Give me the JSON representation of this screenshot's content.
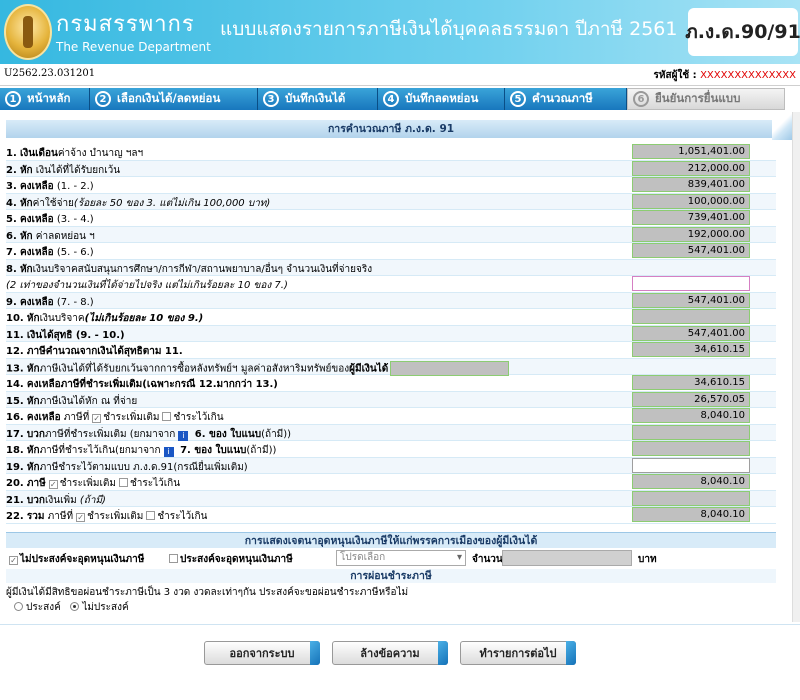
{
  "header": {
    "dept_thai": "กรมสรรพากร",
    "dept_en": "The Revenue Department",
    "form_title": "แบบแสดงรายการภาษีเงินได้บุคคลธรรมดา ปีภาษี 2561",
    "form_code": "ภ.ง.ด.90/91"
  },
  "subheader": {
    "version": "U2562.23.031201",
    "user_label": "รหัสผู้ใช้ :",
    "user_id": "XXXXXXXXXXXXXX"
  },
  "steps": [
    {
      "num": "1",
      "label": "หน้าหลัก",
      "active": true
    },
    {
      "num": "2",
      "label": "เลือกเงินได้/ลดหย่อน",
      "active": true
    },
    {
      "num": "3",
      "label": "บันทึกเงินได้",
      "active": true
    },
    {
      "num": "4",
      "label": "บันทึกลดหย่อน",
      "active": true
    },
    {
      "num": "5",
      "label": "คำนวณภาษี",
      "active": true
    },
    {
      "num": "6",
      "label": "ยืนยันการยื่นแบบ",
      "active": false
    }
  ],
  "calc": {
    "title": "การคำนวณภาษี ภ.ง.ด. 91",
    "r1": {
      "no": "1.",
      "bold": "เงินเดือน",
      "rest": "ค่าจ้าง บำนาญ ฯลฯ",
      "value": "1,051,401.00"
    },
    "r2": {
      "no": "2.",
      "bold": "หัก",
      "rest": " เงินได้ที่ได้รับยกเว้น",
      "value": "212,000.00"
    },
    "r3": {
      "no": "3.",
      "bold": "คงเหลือ",
      "rest": " (1. - 2.)",
      "value": "839,401.00"
    },
    "r4": {
      "no": "4.",
      "bold": "หัก",
      "rest": "ค่าใช้จ่าย",
      "italic": "(ร้อยละ 50 ของ 3. แต่ไม่เกิน 100,000 บาท)",
      "value": "100,000.00"
    },
    "r5": {
      "no": "5.",
      "bold": "คงเหลือ",
      "rest": " (3. - 4.)",
      "value": "739,401.00"
    },
    "r6": {
      "no": "6.",
      "bold": "หัก",
      "rest": " ค่าลดหย่อน ฯ",
      "value": "192,000.00"
    },
    "r7": {
      "no": "7.",
      "bold": "คงเหลือ",
      "rest": " (5. - 6.)",
      "value": "547,401.00"
    },
    "r8": {
      "no": "8.",
      "bold": "หัก",
      "rest": "เงินบริจาคสนับสนุนการศึกษา/การกีฬา/สถานพยาบาล/อื่นๆ จำนวนเงินที่จ่ายจริง"
    },
    "r8b": {
      "italic": "(2 เท่าของจำนวนเงินที่ได้จ่ายไปจริง แต่ไม่เกินร้อยละ 10 ของ 7.)",
      "value": ""
    },
    "r9": {
      "no": "9.",
      "bold": "คงเหลือ",
      "rest": " (7. - 8.)",
      "value": "547,401.00"
    },
    "r10": {
      "no": "10.",
      "bold": "หัก",
      "rest": "เงินบริจาค",
      "italic": "(ไม่เกินร้อยละ 10 ของ 9.)",
      "value": ""
    },
    "r11": {
      "no": "11.",
      "bold": "เงินได้สุทธิ",
      "rest": " (9. - 10.)",
      "value": "547,401.00"
    },
    "r12": {
      "no": "12.",
      "bold": "ภาษีคำนวณจากเงินได้สุทธิตาม 11.",
      "value": "34,610.15"
    },
    "r13": {
      "no": "13.",
      "bold": "หัก",
      "rest": "ภาษีเงินได้ที่ได้รับยกเว้นจากการซื้อหลังทรัพย์ฯ มูลค่าอสังหาริมทรัพย์ของ",
      "bold2": "ผู้มีเงินได้"
    },
    "r14": {
      "no": "14.",
      "bold": "คงเหลือภาษีที่ชำระเพิ่มเติม",
      "rest": "(เฉพาะกรณี 12.มากกว่า 13.)",
      "value": "34,610.15"
    },
    "r15": {
      "no": "15.",
      "bold": "หัก",
      "rest": "ภาษีเงินได้หัก ณ ที่จ่าย",
      "value": "26,570.05"
    },
    "r16": {
      "no": "16.",
      "bold": "คงเหลือ",
      "rest": " ภาษีที่",
      "opt1": "ชำระเพิ่มเติม",
      "opt2": "ชำระไว้เกิน",
      "value": "8,040.10"
    },
    "r17": {
      "no": "17.",
      "bold": "บวก",
      "rest": "ภาษีที่ชำระเพิ่มเติม (ยกมาจาก",
      "tail_bold": " 6. ของ ใบแนบ",
      "tail": "(ถ้ามี))",
      "value": ""
    },
    "r18": {
      "no": "18.",
      "bold": "หัก",
      "rest": "ภาษีที่ชำระไว้เกิน(ยกมาจาก",
      "tail_bold": " 7. ของ ใบแนบ",
      "tail": "(ถ้ามี))",
      "value": ""
    },
    "r19": {
      "no": "19.",
      "bold": "หัก",
      "rest": "ภาษีชำระไว้ตามแบบ ภ.ง.ด.91(กรณียื่นเพิ่มเติม)",
      "value": ""
    },
    "r20": {
      "no": "20.",
      "bold": "ภาษี",
      "opt1": "ชำระเพิ่มเติม",
      "opt2": "ชำระไว้เกิน",
      "value": "8,040.10"
    },
    "r21": {
      "no": "21.",
      "bold": "บวก",
      "rest": "เงินเพิ่ม",
      "italic": " (ถ้ามี)",
      "value": ""
    },
    "r22": {
      "no": "22.",
      "bold": "รวม",
      "rest": " ภาษีที่",
      "opt1": "ชำระเพิ่มเติม",
      "opt2": "ชำระไว้เกิน",
      "value": "8,040.10"
    }
  },
  "donation": {
    "title": "การแสดงเจตนาอุดหนุนเงินภาษีให้แก่พรรคการเมืองของผู้มีเงินได้",
    "opt_no": "ไม่ประสงค์จะอุดหนุนเงินภาษี",
    "opt_yes": "ประสงค์จะอุดหนุนเงินภาษี",
    "select_placeholder": "โปรดเลือก",
    "amount_label": "จำนวน",
    "unit": "บาท"
  },
  "installment": {
    "title": "การผ่อนชำระภาษี",
    "question": "ผู้มีเงินได้มีสิทธิขอผ่อนชำระภาษีเป็น 3 งวด งวดละเท่าๆกัน ประสงค์จะขอผ่อนชำระภาษีหรือไม่",
    "opt_yes": "ประสงค์",
    "opt_no": "ไม่ประสงค์"
  },
  "buttons": {
    "logout": "ออกจากระบบ",
    "clear": "ล้างข้อความ",
    "next": "ทำรายการต่อไป"
  },
  "colors": {
    "header_blue": "#35b8e0",
    "step_blue": "#1877bd",
    "value_gray": "#c0c0c0",
    "value_border": "#8ccc72",
    "user_red": "#e00000"
  }
}
